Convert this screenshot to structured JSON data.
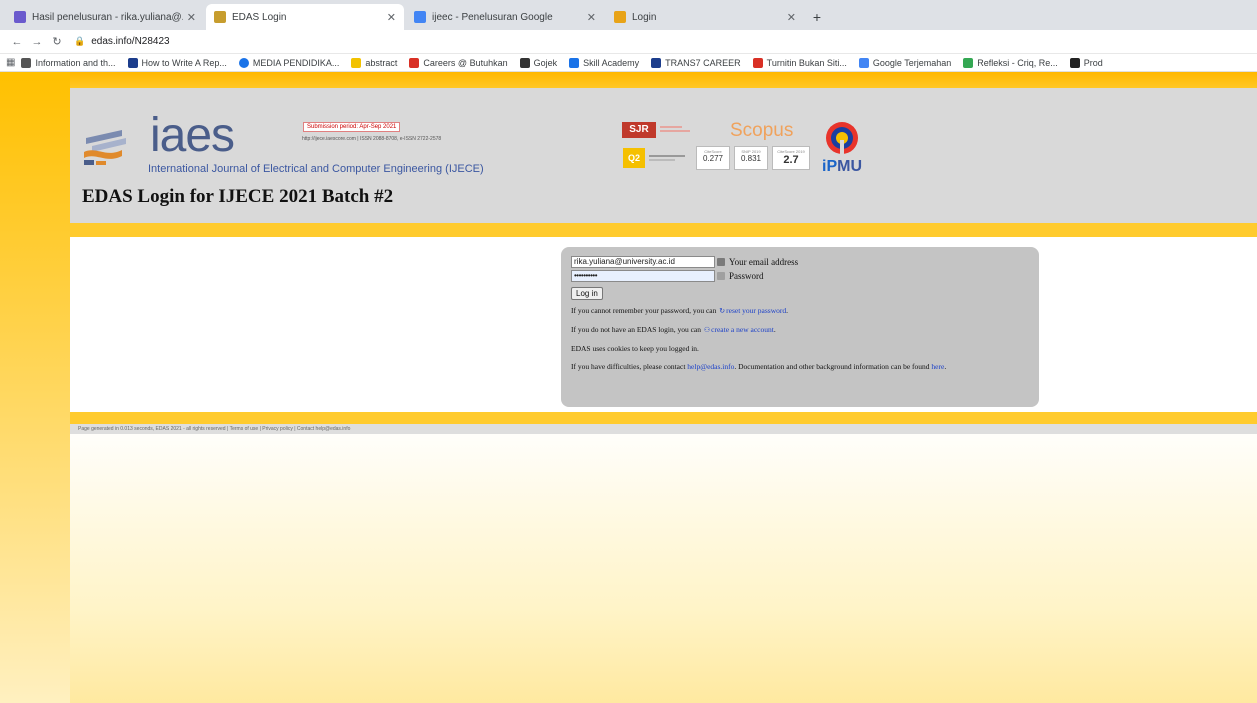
{
  "browser": {
    "tabs": [
      {
        "title": "Hasil penelusuran - rika.yuliana@...",
        "active": false,
        "favicon_color": "#6a5acd"
      },
      {
        "title": "EDAS Login",
        "active": true,
        "favicon_color": "#c79d2e"
      },
      {
        "title": "ijeec - Penelusuran Google",
        "active": false,
        "favicon_color": "#4285f4"
      },
      {
        "title": "Login",
        "active": false,
        "favicon_color": "#e8a317"
      }
    ],
    "new_tab": "+",
    "url": "edas.info/N28423",
    "bookmarks": [
      {
        "label": "Information and th...",
        "color": "#555"
      },
      {
        "label": "How to Write A Rep...",
        "color": "#1c3d8c"
      },
      {
        "label": "MEDIA PENDIDIKA...",
        "color": "#1a73e8"
      },
      {
        "label": "abstract",
        "color": "#f2c200"
      },
      {
        "label": "Careers @ Butuhkan",
        "color": "#d93025"
      },
      {
        "label": "Gojek",
        "color": "#333"
      },
      {
        "label": "Skill Academy",
        "color": "#1a73e8"
      },
      {
        "label": "TRANS7 CAREER",
        "color": "#1c3d8c"
      },
      {
        "label": "Turnitin Bukan Siti...",
        "color": "#d93025"
      },
      {
        "label": "Google Terjemahan",
        "color": "#4285f4"
      },
      {
        "label": "Refleksi - Criq, Re...",
        "color": "#34a853"
      },
      {
        "label": "Prod",
        "color": "#222"
      }
    ]
  },
  "header": {
    "logo_text": "iaes",
    "journal_name": "International Journal of Electrical and Computer Engineering (IJECE)",
    "submission_note": "Submission period: Apr-Sep 2021",
    "issn": "http://ijece.iaescore.com  |  ISSN 2088-8708, e-ISSN 2722-2578",
    "page_title": "EDAS Login for IJECE 2021 Batch #2",
    "sjr_label": "SJR",
    "scopus_label": "Scopus",
    "q_label": "Q2",
    "metrics": [
      {
        "label": "CiteScore",
        "value": "0.277"
      },
      {
        "label": "SNIP 2019",
        "value": "0.831"
      },
      {
        "label": "CiteScore 2019",
        "value": "2.7"
      }
    ],
    "ipmu_prefix": "iP",
    "ipmu_suffix": "MU"
  },
  "login": {
    "email_value": "rika.yuliana@university.ac.id",
    "email_label": "Your email address",
    "password_value": "••••••••••",
    "password_label": "Password",
    "button_label": "Log in",
    "note_reset_pre": "If you cannot remember your password, you can",
    "note_reset_link": "reset your password",
    "note_create_pre": "If you do not have an EDAS login, you can",
    "note_create_link": "create a new account",
    "note_cookies": "EDAS uses cookies to keep you logged in.",
    "note_help_pre": "If you have difficulties, please contact",
    "note_help_link": "help@edas.info",
    "note_help_mid": ". Documentation and other background information can be found",
    "note_help_link2": "here"
  },
  "footer": {
    "text": "Page generated in 0.013 seconds, EDAS 2021 - all rights reserved | Terms of use | Privacy policy | Contact help@edas.info"
  }
}
